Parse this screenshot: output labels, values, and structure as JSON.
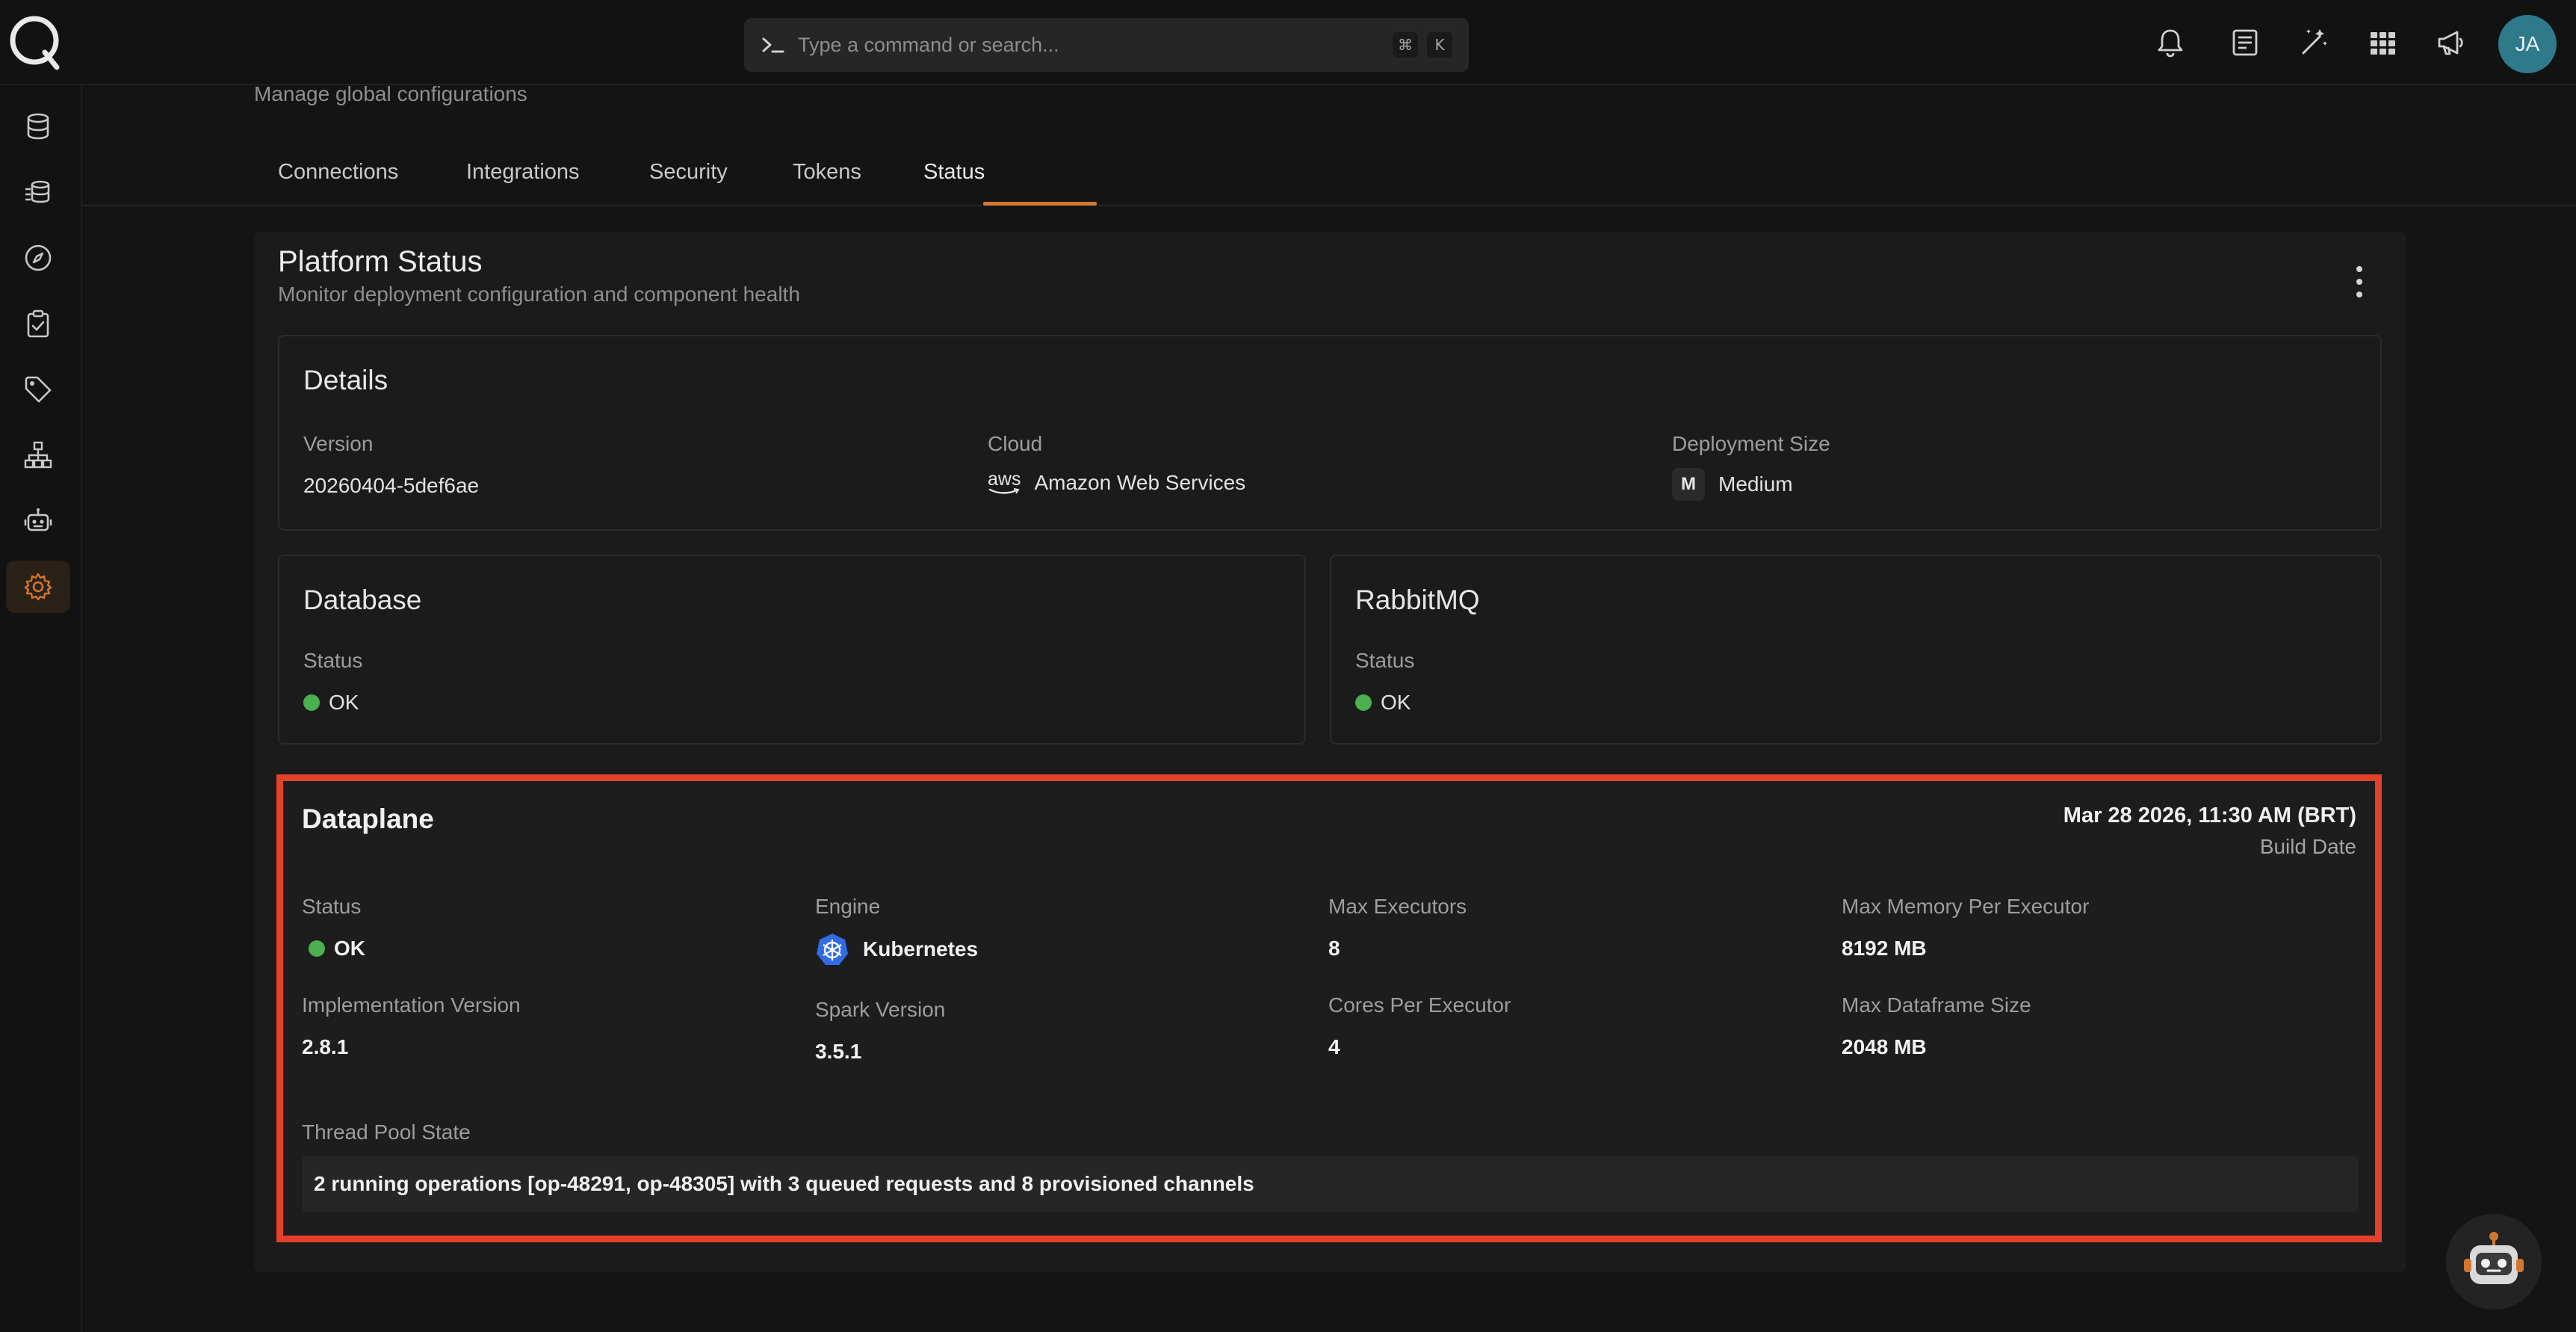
{
  "search": {
    "placeholder": "Type a command or search...",
    "shortcut_keys": [
      "⌘",
      "K"
    ]
  },
  "topbar": {
    "icons": [
      "bell-icon",
      "document-icon",
      "magic-wand-icon",
      "grid-icon",
      "megaphone-icon"
    ],
    "avatar_initials": "JA",
    "avatar_color": "#2e7a8a"
  },
  "sidebar": {
    "items": [
      {
        "icon": "database-icon"
      },
      {
        "icon": "data-stack-icon"
      },
      {
        "icon": "compass-icon"
      },
      {
        "icon": "clipboard-check-icon"
      },
      {
        "icon": "tag-icon"
      },
      {
        "icon": "hierarchy-icon"
      },
      {
        "icon": "robot-icon"
      },
      {
        "icon": "gear-icon",
        "active": true
      }
    ]
  },
  "header": {
    "subtitle": "Manage global configurations"
  },
  "tabs": [
    {
      "label": "Connections"
    },
    {
      "label": "Integrations"
    },
    {
      "label": "Security"
    },
    {
      "label": "Tokens"
    },
    {
      "label": "Status",
      "active": true
    }
  ],
  "accent_color": "#d3762f",
  "platform_status": {
    "title": "Platform Status",
    "subtitle": "Monitor deployment configuration and component health",
    "details": {
      "title": "Details",
      "version_label": "Version",
      "version_value": "20260404-5def6ae",
      "cloud_label": "Cloud",
      "cloud_logo_text": "aws",
      "cloud_value": "Amazon Web Services",
      "size_label": "Deployment Size",
      "size_badge": "M",
      "size_value": "Medium"
    },
    "database": {
      "title": "Database",
      "status_label": "Status",
      "status_value": "OK"
    },
    "rabbitmq": {
      "title": "RabbitMQ",
      "status_label": "Status",
      "status_value": "OK"
    },
    "dataplane": {
      "title": "Dataplane",
      "build_date": "Mar 28 2026, 11:30 AM (BRT)",
      "build_date_label": "Build Date",
      "status_label": "Status",
      "status_value": "OK",
      "engine_label": "Engine",
      "engine_value": "Kubernetes",
      "max_executors_label": "Max Executors",
      "max_executors_value": "8",
      "max_memory_label": "Max Memory Per Executor",
      "max_memory_value": "8192 MB",
      "impl_version_label": "Implementation Version",
      "impl_version_value": "2.8.1",
      "spark_version_label": "Spark Version",
      "spark_version_value": "3.5.1",
      "cores_label": "Cores Per Executor",
      "cores_value": "4",
      "max_df_label": "Max Dataframe Size",
      "max_df_value": "2048 MB",
      "thread_pool_label": "Thread Pool State",
      "thread_pool_value": "2 running operations [op-48291, op-48305] with 3 queued requests and 8 provisioned channels"
    },
    "status_ok_color": "#4caf50",
    "highlight_color": "#e5412a"
  }
}
